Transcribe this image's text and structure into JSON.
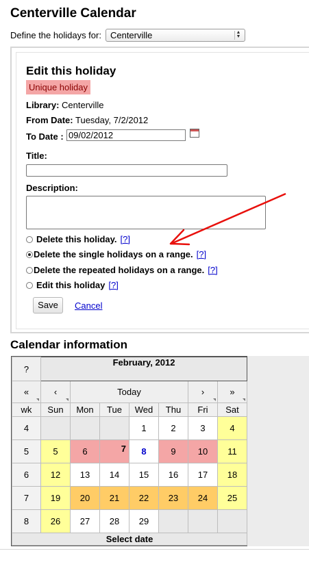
{
  "header": {
    "title": "Centerville Calendar",
    "define_label": "Define the holidays for:",
    "library_select": "Centerville"
  },
  "edit_panel": {
    "title": "Edit this holiday",
    "badge": "Unique holiday",
    "library_label": "Library:",
    "library_value": "Centerville",
    "from_label": "From Date:",
    "from_value": "Tuesday, 7/2/2012",
    "to_label": "To Date :",
    "to_value": "09/02/2012",
    "title_label": "Title:",
    "title_value": "",
    "description_label": "Description:",
    "description_value": "",
    "options": [
      {
        "label": "Delete this holiday.",
        "help": "[?]",
        "checked": false
      },
      {
        "label": "Delete the single holidays on a range.",
        "help": "[?]",
        "checked": true
      },
      {
        "label": "Delete the repeated holidays on a range.",
        "help": "[?]",
        "checked": false
      },
      {
        "label": "Edit this holiday",
        "help": "[?]",
        "checked": false
      }
    ],
    "save_label": "Save",
    "cancel_label": "Cancel"
  },
  "annotation": {
    "color": "#e8100c"
  },
  "calendar": {
    "section_title": "Calendar information",
    "help": "?",
    "month_title": "February, 2012",
    "nav": {
      "prev_year": "«",
      "prev_month": "‹",
      "today": "Today",
      "next_month": "›",
      "next_year": "»"
    },
    "days": [
      "wk",
      "Sun",
      "Mon",
      "Tue",
      "Wed",
      "Thu",
      "Fri",
      "Sat"
    ],
    "weeks": [
      {
        "wk": "4",
        "days": [
          [
            "",
            ""
          ],
          [
            "",
            ""
          ],
          [
            "",
            ""
          ],
          [
            "1",
            "plain"
          ],
          [
            "2",
            "plain"
          ],
          [
            "3",
            "plain"
          ],
          [
            "4",
            "yellow"
          ]
        ]
      },
      {
        "wk": "5",
        "days": [
          [
            "5",
            "yellow"
          ],
          [
            "6",
            "pink"
          ],
          [
            "7",
            "today"
          ],
          [
            "8",
            "bluebold"
          ],
          [
            "9",
            "pink"
          ],
          [
            "10",
            "pink"
          ],
          [
            "11",
            "yellow"
          ]
        ]
      },
      {
        "wk": "6",
        "days": [
          [
            "12",
            "yellow"
          ],
          [
            "13",
            "plain"
          ],
          [
            "14",
            "plain"
          ],
          [
            "15",
            "plain"
          ],
          [
            "16",
            "plain"
          ],
          [
            "17",
            "plain"
          ],
          [
            "18",
            "yellow"
          ]
        ]
      },
      {
        "wk": "7",
        "days": [
          [
            "19",
            "yellow"
          ],
          [
            "20",
            "orange"
          ],
          [
            "21",
            "orange"
          ],
          [
            "22",
            "orange"
          ],
          [
            "23",
            "orange"
          ],
          [
            "24",
            "orange"
          ],
          [
            "25",
            "yellow"
          ]
        ]
      },
      {
        "wk": "8",
        "days": [
          [
            "26",
            "yellow"
          ],
          [
            "27",
            "plain"
          ],
          [
            "28",
            "plain"
          ],
          [
            "29",
            "plain"
          ],
          [
            "",
            ""
          ],
          [
            "",
            ""
          ],
          [
            "",
            ""
          ]
        ]
      }
    ],
    "footer": "Select date",
    "colors": {
      "weekend": "#ffff99",
      "holiday": "#f4a6a6",
      "range": "#ffcc66"
    }
  }
}
